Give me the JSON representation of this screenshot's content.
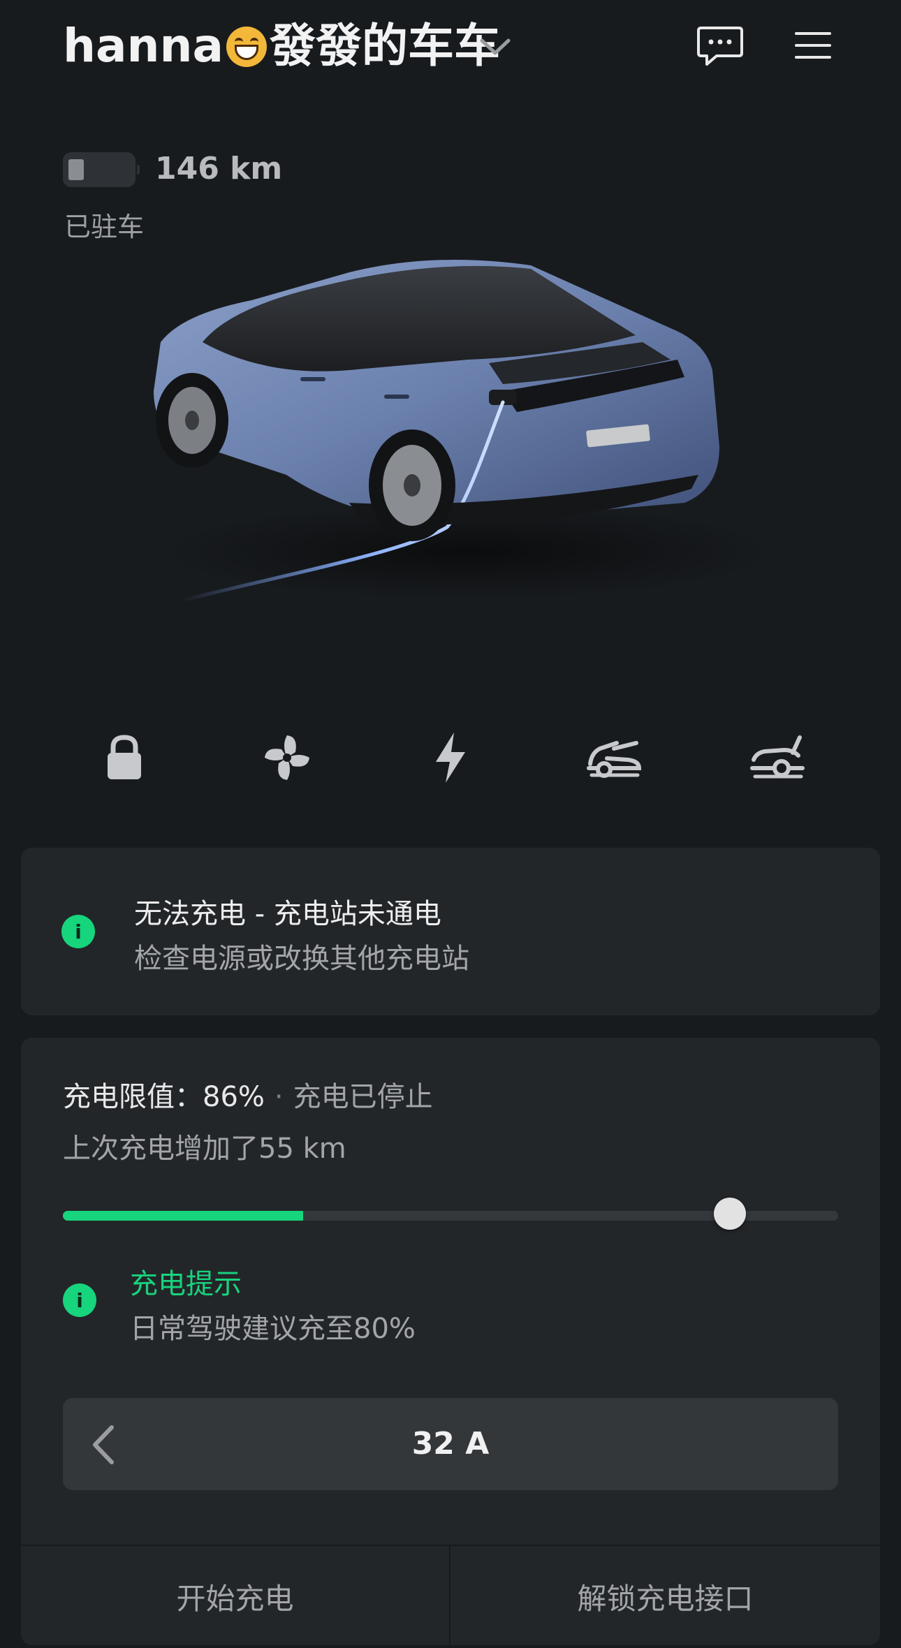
{
  "header": {
    "car_name_prefix": "hanna",
    "car_name_emoji": "grinning-face-emoji",
    "car_name_suffix": "發發的车车",
    "range": "146 km",
    "status": "已驻车"
  },
  "icons": {
    "dropdown": "chevron-down-icon",
    "messages": "chat-bubble-icon",
    "menu": "hamburger-menu-icon"
  },
  "quick_controls": [
    {
      "name": "lock-icon"
    },
    {
      "name": "fan-icon"
    },
    {
      "name": "charge-bolt-icon"
    },
    {
      "name": "frunk-icon"
    },
    {
      "name": "trunk-icon"
    }
  ],
  "alert": {
    "title": "无法充电 - 充电站未通电",
    "subtitle": "检查电源或改换其他充电站"
  },
  "charging": {
    "limit_label": "充电限值：",
    "limit_value": "86%",
    "separator": "·",
    "status": "充电已停止",
    "last_session": "上次充电增加了55 km",
    "current_level": 0.31,
    "limit_level": 0.86,
    "tip_title": "充电提示",
    "tip_body": "日常驾驶建议充至80%",
    "amperage": "32 A",
    "start_button": "开始充电",
    "unlock_button": "解锁充电接口"
  },
  "colors": {
    "accent_green": "#16d57c",
    "background": "#181b1e",
    "card": "#232629",
    "car_paint": "#6f86b4"
  }
}
